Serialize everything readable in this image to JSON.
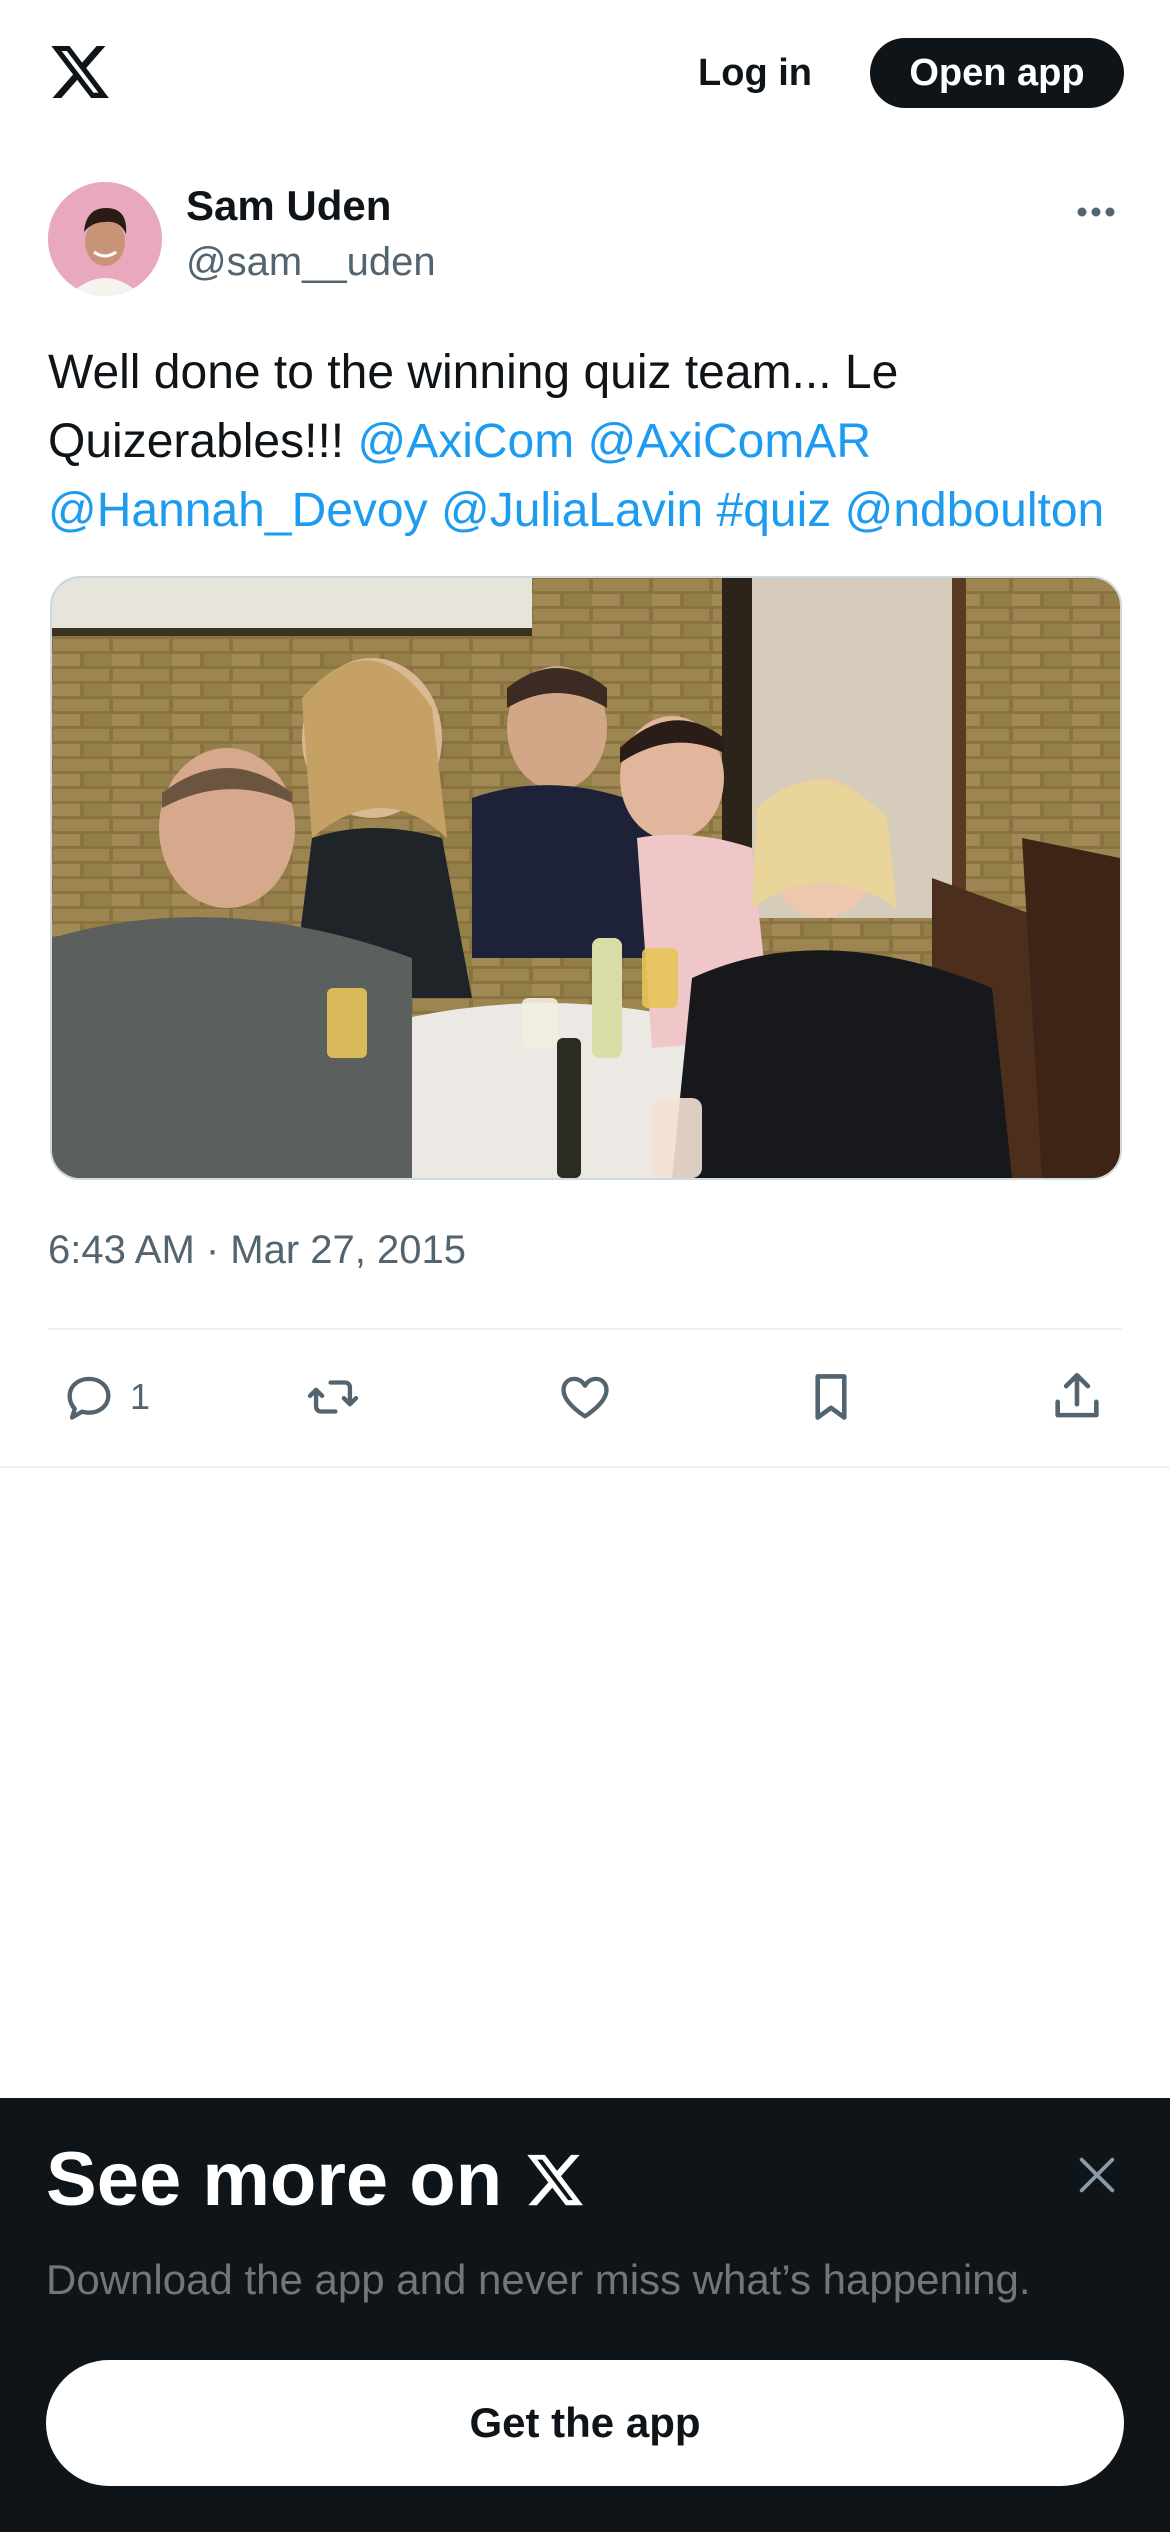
{
  "header": {
    "login_label": "Log in",
    "open_app_label": "Open app"
  },
  "tweet": {
    "display_name": "Sam Uden",
    "handle": "@sam__uden",
    "text_plain_1": "Well done to the winning quiz team... Le Quizerables!!! ",
    "links": [
      "@AxiCom",
      "@AxiComAR",
      "@Hannah_Devoy",
      "@JuliaLavin",
      "#quiz",
      "@ndboulton"
    ],
    "timestamp": "6:43 AM · Mar 27, 2015",
    "reply_count": "1"
  },
  "promo": {
    "title": "See more on",
    "subtitle": "Download the app and never miss what’s happening.",
    "cta_label": "Get the app"
  },
  "colors": {
    "text": "#0f1419",
    "secondary_text": "#536471",
    "link": "#1d9bf0",
    "promo_bg": "#0f1419"
  },
  "icons": [
    "x-logo-icon",
    "more-icon",
    "reply-icon",
    "retweet-icon",
    "like-icon",
    "bookmark-icon",
    "share-icon",
    "close-icon"
  ]
}
